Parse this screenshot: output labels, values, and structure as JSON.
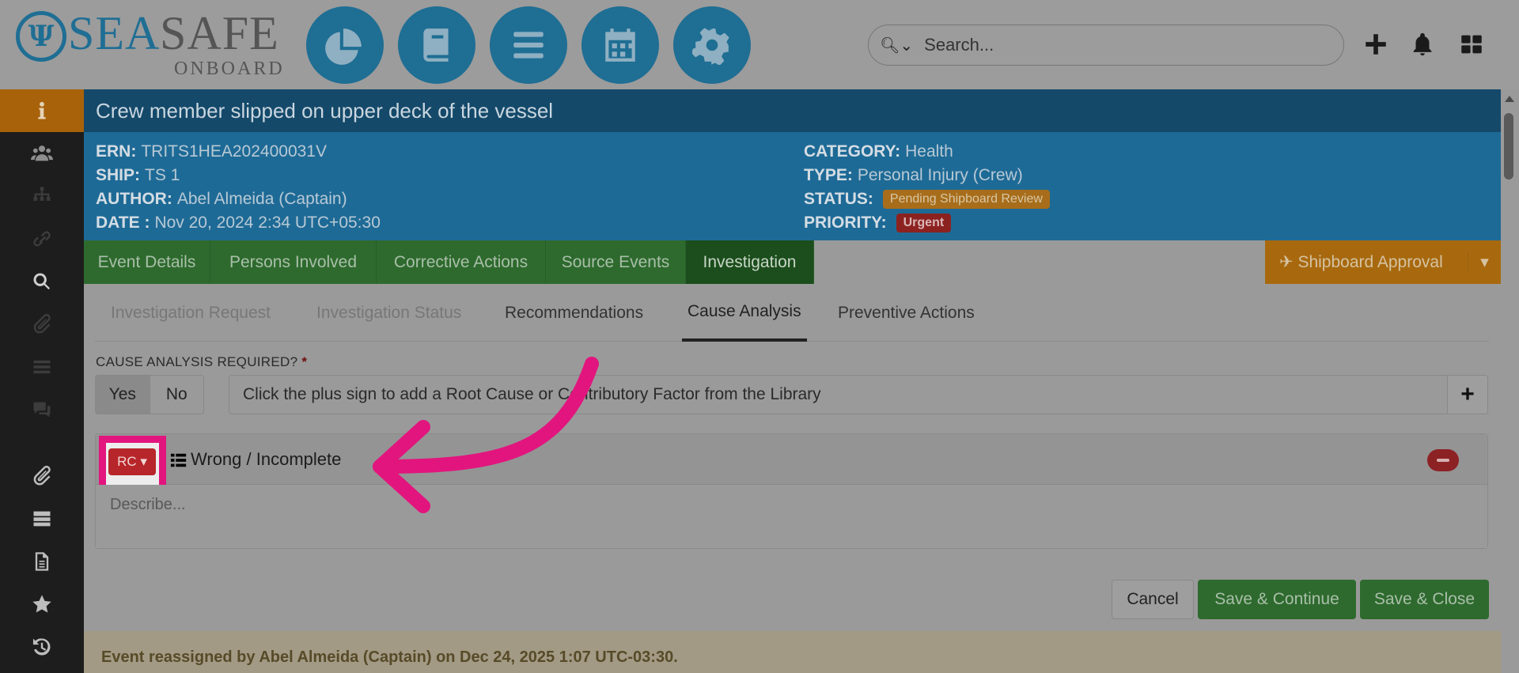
{
  "brand": {
    "mark": "Ψ",
    "sea": "SEA",
    "safe": "SAFE",
    "onboard": "ONBOARD"
  },
  "top_nav": [
    {
      "name": "dashboard-icon"
    },
    {
      "name": "book-icon"
    },
    {
      "name": "menu-icon"
    },
    {
      "name": "calendar-icon"
    },
    {
      "name": "gear-icon"
    }
  ],
  "search": {
    "placeholder": "Search..."
  },
  "header_actions": [
    "plus-icon",
    "bell-icon",
    "grid-icon"
  ],
  "sidebar": [
    "info-icon",
    "users-icon",
    "org-chart-icon",
    "link-icon",
    "search-icon",
    "paperclip-icon",
    "list-icon",
    "comments-icon",
    "paperclip-icon",
    "server-icon",
    "document-icon",
    "star-icon",
    "history-icon"
  ],
  "event": {
    "title": "Crew member slipped on upper deck of the vessel",
    "ern_label": "ERN:",
    "ern": "TRITS1HEA202400031V",
    "ship_label": "SHIP:",
    "ship": "TS 1",
    "author_label": "AUTHOR:",
    "author": "Abel Almeida (Captain)",
    "date_label": "DATE :",
    "date": "Nov 20, 2024 2:34 UTC+05:30",
    "category_label": "CATEGORY:",
    "category": "Health",
    "type_label": "TYPE:",
    "type": "Personal Injury (Crew)",
    "status_label": "STATUS:",
    "status": "Pending Shipboard Review",
    "priority_label": "PRIORITY:",
    "priority": "Urgent"
  },
  "tabs": [
    "Event Details",
    "Persons Involved",
    "Corrective Actions",
    "Source Events",
    "Investigation"
  ],
  "approval": {
    "label": "Shipboard Approval"
  },
  "subtabs": [
    "Investigation Request",
    "Investigation Status",
    "Recommendations",
    "Cause Analysis",
    "Preventive Actions"
  ],
  "cause": {
    "required_label": "CAUSE ANALYSIS REQUIRED?",
    "required_star": "*",
    "yes": "Yes",
    "no": "No",
    "library_hint": "Click the plus sign to add a Root Cause or Contributory Factor from the Library",
    "add": "+",
    "item_badge": "RC ▾",
    "item_text": "Wrong / Incomplete",
    "describe_placeholder": "Describe..."
  },
  "buttons": {
    "cancel": "Cancel",
    "save_continue": "Save & Continue",
    "save_close": "Save & Close"
  },
  "notice": "Event reassigned by Abel Almeida (Captain) on Dec 24, 2025 1:07 UTC-03:30.",
  "colors": {
    "brand_blue": "#1f6e94",
    "highlight": "#e2157e",
    "green": "#2e6a2e",
    "orange": "#a8690e",
    "red": "#b7262a"
  }
}
